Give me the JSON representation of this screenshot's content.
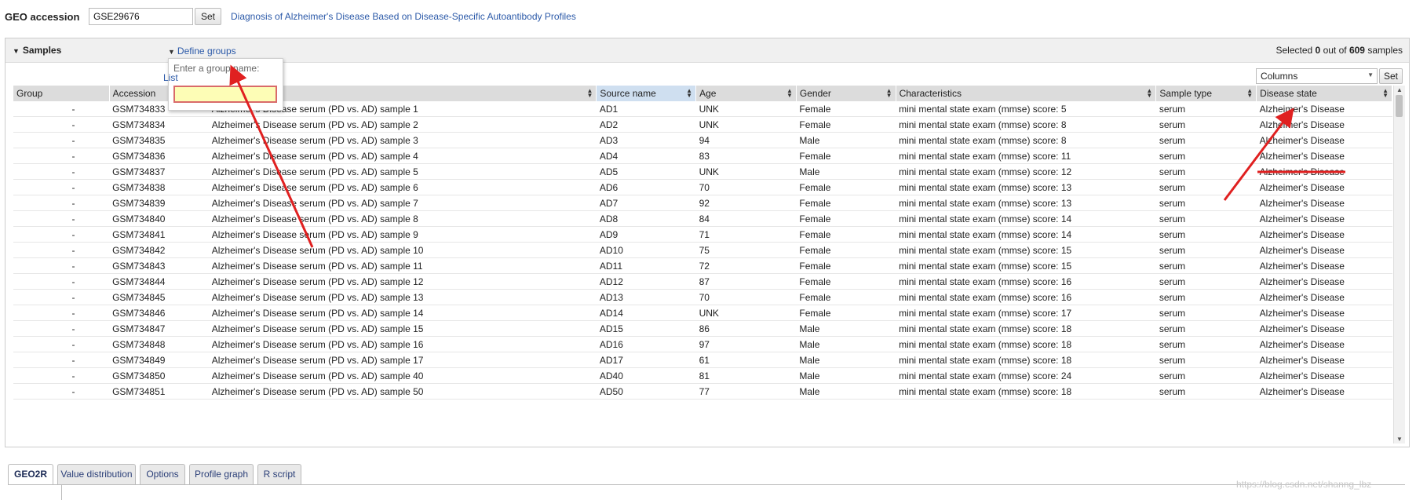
{
  "geo": {
    "label": "GEO accession",
    "input_value": "GSE29676",
    "set_label": "Set",
    "dataset_title": "Diagnosis of Alzheimer's Disease Based on Disease-Specific Autoantibody Profiles"
  },
  "samples": {
    "title": "Samples",
    "define_groups_label": "Define groups",
    "selected_prefix": "Selected",
    "selected_count": "0",
    "selected_middle": "out of",
    "total_count": "609",
    "selected_suffix": "samples",
    "columns_select_value": "Columns",
    "columns_set_label": "Set"
  },
  "group_popup": {
    "prompt": "Enter a group name:",
    "list_label": "List",
    "input_value": ""
  },
  "table": {
    "headers": [
      "Group",
      "Accession",
      "",
      "Source name",
      "Age",
      "Gender",
      "Characteristics",
      "Sample type",
      "Disease state"
    ],
    "sorted_column": "Source name",
    "rows": [
      [
        "-",
        "GSM734833",
        "Alzheimer's Disease serum (PD vs. AD) sample 1",
        "AD1",
        "UNK",
        "Female",
        "mini mental state exam (mmse) score: 5",
        "serum",
        "Alzheimer's Disease"
      ],
      [
        "-",
        "GSM734834",
        "Alzheimer's Disease serum (PD vs. AD) sample 2",
        "AD2",
        "UNK",
        "Female",
        "mini mental state exam (mmse) score: 8",
        "serum",
        "Alzheimer's Disease"
      ],
      [
        "-",
        "GSM734835",
        "Alzheimer's Disease serum (PD vs. AD) sample 3",
        "AD3",
        "94",
        "Male",
        "mini mental state exam (mmse) score: 8",
        "serum",
        "Alzheimer's Disease"
      ],
      [
        "-",
        "GSM734836",
        "Alzheimer's Disease serum (PD vs. AD) sample 4",
        "AD4",
        "83",
        "Female",
        "mini mental state exam (mmse) score: 11",
        "serum",
        "Alzheimer's Disease"
      ],
      [
        "-",
        "GSM734837",
        "Alzheimer's Disease serum (PD vs. AD) sample 5",
        "AD5",
        "UNK",
        "Male",
        "mini mental state exam (mmse) score: 12",
        "serum",
        "Alzheimer's Disease"
      ],
      [
        "-",
        "GSM734838",
        "Alzheimer's Disease serum (PD vs. AD) sample 6",
        "AD6",
        "70",
        "Female",
        "mini mental state exam (mmse) score: 13",
        "serum",
        "Alzheimer's Disease"
      ],
      [
        "-",
        "GSM734839",
        "Alzheimer's Disease serum (PD vs. AD) sample 7",
        "AD7",
        "92",
        "Female",
        "mini mental state exam (mmse) score: 13",
        "serum",
        "Alzheimer's Disease"
      ],
      [
        "-",
        "GSM734840",
        "Alzheimer's Disease serum (PD vs. AD) sample 8",
        "AD8",
        "84",
        "Female",
        "mini mental state exam (mmse) score: 14",
        "serum",
        "Alzheimer's Disease"
      ],
      [
        "-",
        "GSM734841",
        "Alzheimer's Disease serum (PD vs. AD) sample 9",
        "AD9",
        "71",
        "Female",
        "mini mental state exam (mmse) score: 14",
        "serum",
        "Alzheimer's Disease"
      ],
      [
        "-",
        "GSM734842",
        "Alzheimer's Disease serum (PD vs. AD) sample 10",
        "AD10",
        "75",
        "Female",
        "mini mental state exam (mmse) score: 15",
        "serum",
        "Alzheimer's Disease"
      ],
      [
        "-",
        "GSM734843",
        "Alzheimer's Disease serum (PD vs. AD) sample 11",
        "AD11",
        "72",
        "Female",
        "mini mental state exam (mmse) score: 15",
        "serum",
        "Alzheimer's Disease"
      ],
      [
        "-",
        "GSM734844",
        "Alzheimer's Disease serum (PD vs. AD) sample 12",
        "AD12",
        "87",
        "Female",
        "mini mental state exam (mmse) score: 16",
        "serum",
        "Alzheimer's Disease"
      ],
      [
        "-",
        "GSM734845",
        "Alzheimer's Disease serum (PD vs. AD) sample 13",
        "AD13",
        "70",
        "Female",
        "mini mental state exam (mmse) score: 16",
        "serum",
        "Alzheimer's Disease"
      ],
      [
        "-",
        "GSM734846",
        "Alzheimer's Disease serum (PD vs. AD) sample 14",
        "AD14",
        "UNK",
        "Female",
        "mini mental state exam (mmse) score: 17",
        "serum",
        "Alzheimer's Disease"
      ],
      [
        "-",
        "GSM734847",
        "Alzheimer's Disease serum (PD vs. AD) sample 15",
        "AD15",
        "86",
        "Male",
        "mini mental state exam (mmse) score: 18",
        "serum",
        "Alzheimer's Disease"
      ],
      [
        "-",
        "GSM734848",
        "Alzheimer's Disease serum (PD vs. AD) sample 16",
        "AD16",
        "97",
        "Male",
        "mini mental state exam (mmse) score: 18",
        "serum",
        "Alzheimer's Disease"
      ],
      [
        "-",
        "GSM734849",
        "Alzheimer's Disease serum (PD vs. AD) sample 17",
        "AD17",
        "61",
        "Male",
        "mini mental state exam (mmse) score: 18",
        "serum",
        "Alzheimer's Disease"
      ],
      [
        "-",
        "GSM734850",
        "Alzheimer's Disease serum (PD vs. AD) sample 40",
        "AD40",
        "81",
        "Male",
        "mini mental state exam (mmse) score: 24",
        "serum",
        "Alzheimer's Disease"
      ],
      [
        "-",
        "GSM734851",
        "Alzheimer's Disease serum (PD vs. AD) sample 50",
        "AD50",
        "77",
        "Male",
        "mini mental state exam (mmse) score: 18",
        "serum",
        "Alzheimer's Disease"
      ]
    ]
  },
  "tabs": [
    {
      "label": "GEO2R",
      "active": true
    },
    {
      "label": "Value distribution",
      "active": false
    },
    {
      "label": "Options",
      "active": false
    },
    {
      "label": "Profile graph",
      "active": false
    },
    {
      "label": "R script",
      "active": false
    }
  ],
  "watermark": "https://blog.csdn.net/shanng_lbz",
  "colors": {
    "link": "#2b59a8",
    "annotation_arrow": "#e02020",
    "header_bg": "#dcdcdc",
    "sorted_header_bg": "#cfdff0",
    "popup_input_bg": "#fdfdb6"
  }
}
